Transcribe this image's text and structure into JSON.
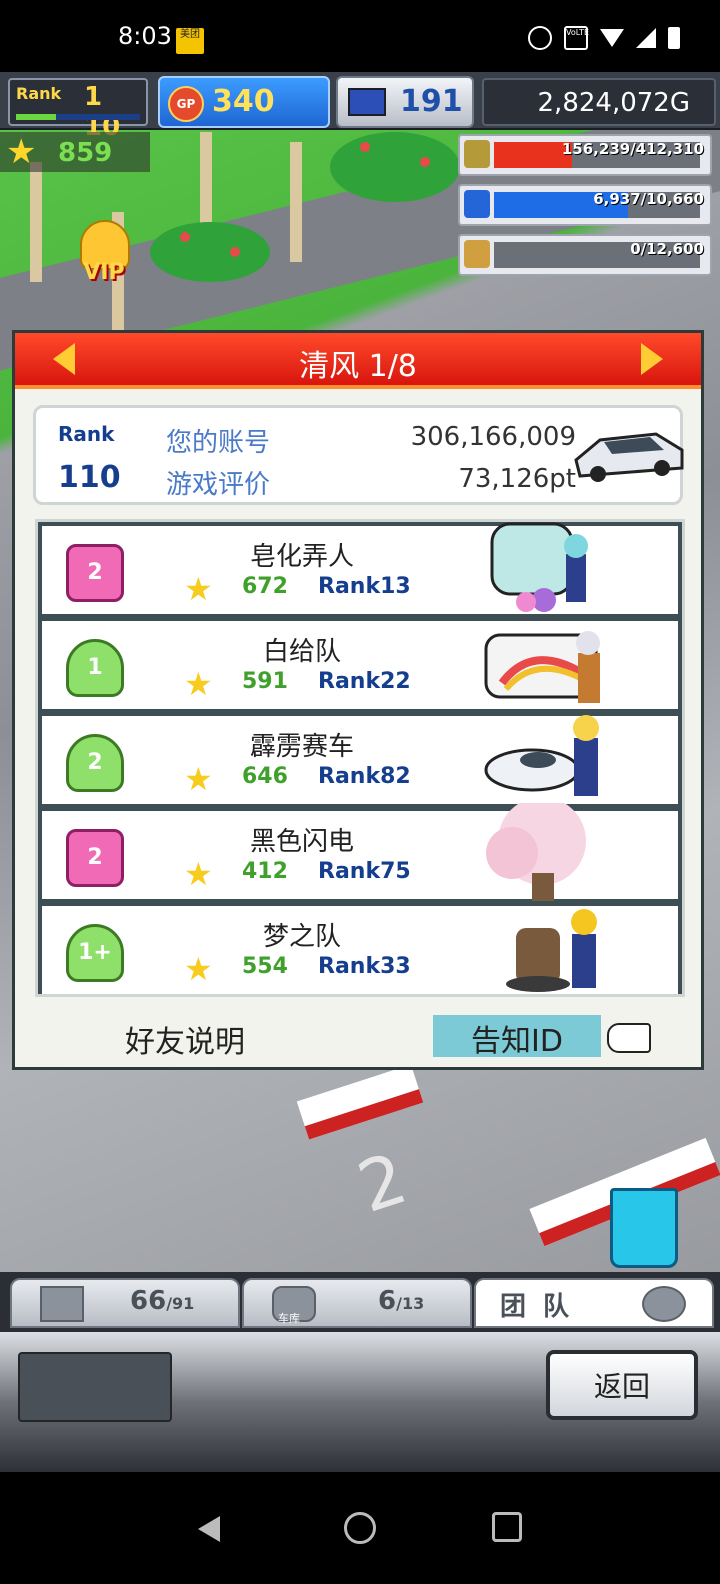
{
  "status_bar": {
    "time": "8:03",
    "app_badge": "美团",
    "volte": "VoLTE"
  },
  "hud": {
    "rank_label": "Rank",
    "rank_value": "1 10",
    "gp_label": "GP",
    "gp_value": "340",
    "pc_value": "191",
    "money": "2,824,072G",
    "stars": "859",
    "resources": [
      {
        "name": "fuel",
        "text": "156,239/412,310",
        "fill_fraction": 0.38,
        "color": "#e8321e"
      },
      {
        "name": "oil",
        "text": "6,937/10,660",
        "fill_fraction": 0.65,
        "color": "#1f6de6"
      },
      {
        "name": "grain",
        "text": "0/12,600",
        "fill_fraction": 0,
        "color": "#6b7078"
      }
    ],
    "vip_label": "VIP"
  },
  "dialog": {
    "title": "清风 1/8",
    "account": {
      "rank_label": "Rank",
      "rank_value": "110",
      "account_label": "您的账号",
      "account_value": "306,166,009",
      "rating_label": "游戏评价",
      "rating_value": "73,126pt"
    },
    "friends": [
      {
        "badge": "2",
        "badge_style": "pink",
        "name": "皂化弄人",
        "stars": "672",
        "rank": "Rank13"
      },
      {
        "badge": "1",
        "badge_style": "green",
        "name": "白给队",
        "stars": "591",
        "rank": "Rank22"
      },
      {
        "badge": "2",
        "badge_style": "green",
        "name": "霹雳赛车",
        "stars": "646",
        "rank": "Rank82"
      },
      {
        "badge": "2",
        "badge_style": "pink",
        "name": "黑色闪电",
        "stars": "412",
        "rank": "Rank75"
      },
      {
        "badge": "1+",
        "badge_style": "green",
        "name": "梦之队",
        "stars": "554",
        "rank": "Rank33"
      }
    ],
    "explain_label": "好友说明",
    "notify_label": "告知ID"
  },
  "scene": {
    "pit_number": "2"
  },
  "tabs": [
    {
      "name": "parts",
      "value": "66",
      "max": "/91"
    },
    {
      "name": "garage",
      "sub_label": "车库",
      "value": "6",
      "max": "/13"
    },
    {
      "name": "team",
      "label": "团 队"
    }
  ],
  "console": {
    "back_label": "返回"
  }
}
